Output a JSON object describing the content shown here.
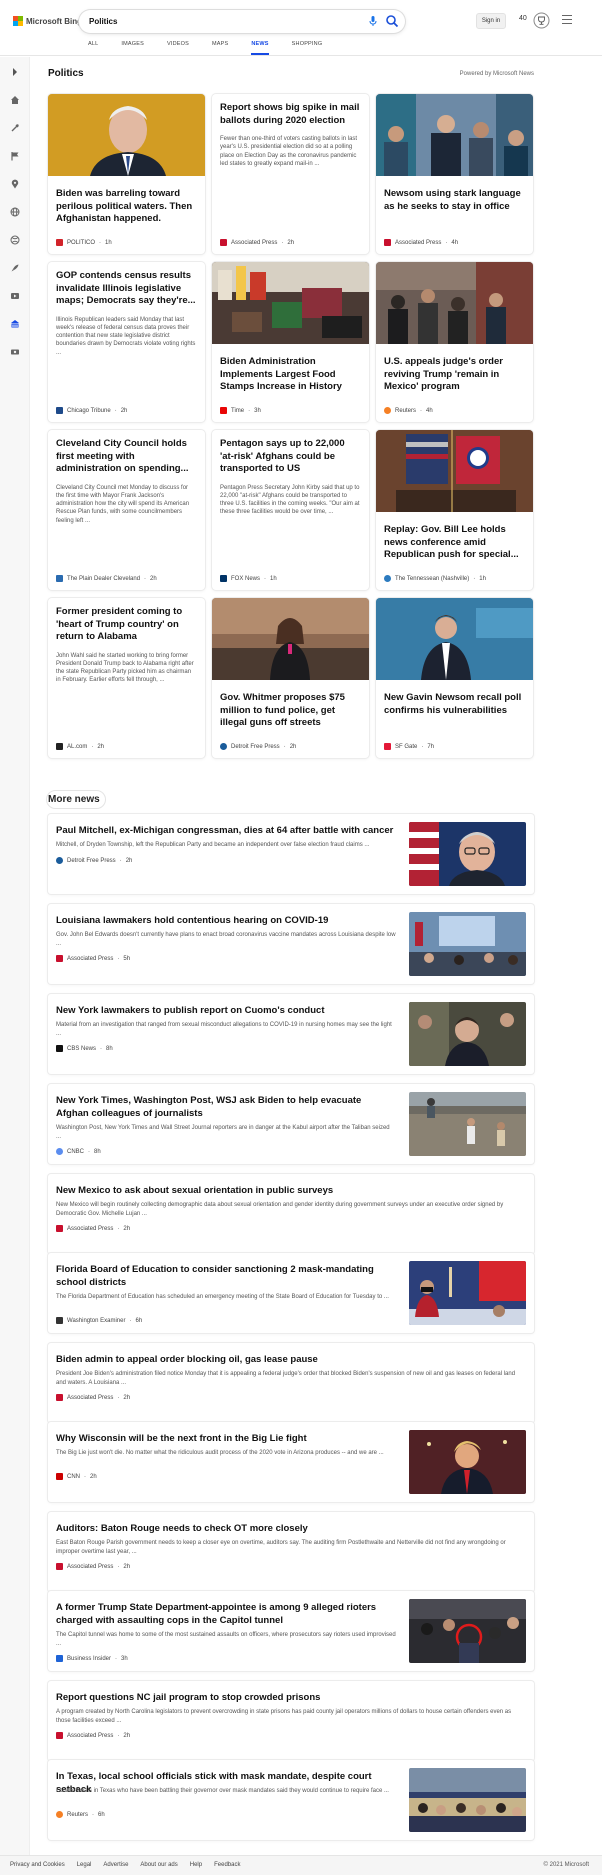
{
  "header": {
    "logo_text": "Microsoft Bing",
    "search_value": "Politics",
    "sign_in": "Sign in",
    "points": "40",
    "tabs": [
      "ALL",
      "IMAGES",
      "VIDEOS",
      "MAPS",
      "NEWS",
      "SHOPPING"
    ],
    "active_tab": "NEWS"
  },
  "section": {
    "title": "Politics",
    "powered_by": "Powered by Microsoft News"
  },
  "cards": [
    {
      "title": "Biden was barreling toward perilous political waters. Then Afghanistan happened.",
      "snippet": "",
      "provider": "POLITICO",
      "time": "1h",
      "image": "biden-portrait",
      "logo_color": "#d2232a"
    },
    {
      "title": "Report shows big spike in mail ballots during 2020 election",
      "snippet": "Fewer than one-third of voters casting ballots in last year's U.S. presidential election did so at a polling place on Election Day as the coronavirus pandemic led states to greatly expand mail-in ...",
      "provider": "Associated Press",
      "time": "2h",
      "image": "",
      "logo_color": "#c8102e"
    },
    {
      "title": "Newsom using stark language as he seeks to stay in office",
      "snippet": "",
      "provider": "Associated Press",
      "time": "4h",
      "image": "newsom-crowd",
      "logo_color": "#c8102e"
    },
    {
      "title": "GOP contends census results invalidate Illinois legislative maps; Democrats say they're...",
      "snippet": "Illinois Republican leaders said Monday that last week's release of federal census data proves their contention that new state legislative district boundaries drawn by Democrats violate voting rights ...",
      "provider": "Chicago Tribune",
      "time": "2h",
      "image": "",
      "logo_color": "#1e4a8a"
    },
    {
      "title": "Biden Administration Implements Largest Food Stamps Increase in History",
      "snippet": "",
      "provider": "Time",
      "time": "3h",
      "image": "grocery-checkout",
      "logo_color": "#e90606"
    },
    {
      "title": "U.S. appeals judge's order reviving Trump 'remain in Mexico' program",
      "snippet": "",
      "provider": "Reuters",
      "time": "4h",
      "image": "border-crowd",
      "logo_color": "#f58025"
    },
    {
      "title": "Cleveland City Council holds first meeting with administration on spending...",
      "snippet": "Cleveland City Council met Monday to discuss for the first time with Mayor Frank Jackson's administration how the city will spend its American Rescue Plan funds, with some councilmembers feeling left ...",
      "provider": "The Plain Dealer Cleveland",
      "time": "2h",
      "image": "",
      "logo_color": "#2a6bb0"
    },
    {
      "title": "Pentagon says up to 22,000 'at-risk' Afghans could be transported to US",
      "snippet": "Pentagon Press Secretary John Kirby said that up to 22,000 \"at-risk\" Afghans could be transported to three U.S. facilities in the coming weeks. \"Our aim at these three facilities would be over time, ...",
      "provider": "FOX News",
      "time": "1h",
      "image": "",
      "logo_color": "#003366"
    },
    {
      "title": "Replay: Gov. Bill Lee holds news conference amid Republican push for special...",
      "snippet": "",
      "provider": "The Tennessean (Nashville)",
      "time": "1h",
      "image": "tennessee-flags",
      "logo_color": "#2c7bbf"
    },
    {
      "title": "Former president coming to 'heart of Trump country' on return to Alabama",
      "snippet": "John Wahl said he started working to bring former President Donald Trump back to Alabama right after the state Republican Party picked him as chairman in February. Earlier efforts fell through, ...",
      "provider": "AL.com",
      "time": "2h",
      "image": "",
      "logo_color": "#222222"
    },
    {
      "title": "Gov. Whitmer proposes $75 million to fund police, get illegal guns off streets",
      "snippet": "",
      "provider": "Detroit Free Press",
      "time": "2h",
      "image": "whitmer-podium",
      "logo_color": "#1a5c9b"
    },
    {
      "title": "New Gavin Newsom recall poll confirms his vulnerabilities",
      "snippet": "",
      "provider": "SF Gate",
      "time": "7h",
      "image": "newsom-stage",
      "logo_color": "#e31837"
    }
  ],
  "more_news": {
    "title": "More news",
    "items": [
      {
        "title": "Paul Mitchell, ex-Michigan congressman, dies at 64 after battle with cancer",
        "snippet": "Mitchell, of Dryden Township, left the Republican Party and became an independent over false election fraud claims ...",
        "provider": "Detroit Free Press",
        "time": "2h",
        "image": "mitchell-portrait",
        "logo_color": "#1a5c9b"
      },
      {
        "title": "Louisiana lawmakers hold contentious hearing on COVID-19",
        "snippet": "Gov. John Bel Edwards doesn't currently have plans to enact broad coronavirus vaccine mandates across Louisiana despite low ...",
        "provider": "Associated Press",
        "time": "5h",
        "image": "hearing-room",
        "logo_color": "#c8102e"
      },
      {
        "title": "New York lawmakers to publish report on Cuomo's conduct",
        "snippet": "Material from an investigation that ranged from sexual misconduct allegations to COVID-19 in nursing homes may see the light ...",
        "provider": "CBS News",
        "time": "8h",
        "image": "cuomo",
        "logo_color": "#111111"
      },
      {
        "title": "New York Times, Washington Post, WSJ ask Biden to help evacuate Afghan colleagues of journalists",
        "snippet": "Washington Post, New York Times and Wall Street Journal reporters are in danger at the Kabul airport after the Taliban seized ...",
        "provider": "CNBC",
        "time": "8h",
        "image": "kabul-wall",
        "logo_color": "#5b8def"
      },
      {
        "title": "New Mexico to ask about sexual orientation in public surveys",
        "snippet": "New Mexico will begin routinely collecting demographic data about sexual orientation and gender identity during government surveys under an executive order signed by Democratic Gov. Michelle Lujan ...",
        "provider": "Associated Press",
        "time": "2h",
        "image": "",
        "logo_color": "#c8102e"
      },
      {
        "title": "Florida Board of Education to consider sanctioning 2 mask-mandating school districts",
        "snippet": "The Florida Department of Education has scheduled an emergency meeting of the State Board of Education for Tuesday to ...",
        "provider": "Washington Examiner",
        "time": "6h",
        "image": "florida-protest",
        "logo_color": "#333333"
      },
      {
        "title": "Biden admin to appeal order blocking oil, gas lease pause",
        "snippet": "President Joe Biden's administration filed notice Monday that it is appealing a federal judge's order that blocked Biden's suspension of new oil and gas leases on federal land and waters. A Louisiana ...",
        "provider": "Associated Press",
        "time": "2h",
        "image": "",
        "logo_color": "#c8102e"
      },
      {
        "title": "Why Wisconsin will be the next front in the Big Lie fight",
        "snippet": "The Big Lie just won't die. No matter what the ridiculous audit process of the 2020 vote in Arizona produces -- and we are ...",
        "provider": "CNN",
        "time": "2h",
        "image": "trump-flags",
        "logo_color": "#cc0000"
      },
      {
        "title": "Auditors: Baton Rouge needs to check OT more closely",
        "snippet": "East Baton Rouge Parish government needs to keep a closer eye on overtime, auditors say. The auditing firm Postlethwaite and Netterville did not find any wrongdoing or improper overtime last year, ...",
        "provider": "Associated Press",
        "time": "2h",
        "image": "",
        "logo_color": "#c8102e"
      },
      {
        "title": "A former Trump State Department-appointee is among 9 alleged rioters charged with assaulting cops in the Capitol tunnel",
        "snippet": "The Capitol tunnel was home to some of the most sustained assaults on officers, where prosecutors say rioters used improvised ...",
        "provider": "Business Insider",
        "time": "3h",
        "image": "capitol-riot",
        "logo_color": "#1e63d6"
      },
      {
        "title": "Report questions NC jail program to stop crowded prisons",
        "snippet": "A program created by North Carolina legislators to prevent overcrowding in state prisons has paid county jail operators millions of dollars to house certain offenders even as those facilities exceed ...",
        "provider": "Associated Press",
        "time": "2h",
        "image": "",
        "logo_color": "#c8102e"
      },
      {
        "title": "In Texas, local school officials stick with mask mandate, despite court setback",
        "snippet": "Local officials in Texas who have been battling their governor over mask mandates said they would continue to require face ...",
        "provider": "Reuters",
        "time": "6h",
        "image": "school-meeting",
        "logo_color": "#f58025"
      }
    ]
  },
  "footer": {
    "links": [
      "Privacy and Cookies",
      "Legal",
      "Advertise",
      "About our ads",
      "Help",
      "Feedback"
    ],
    "copyright": "© 2021 Microsoft"
  }
}
